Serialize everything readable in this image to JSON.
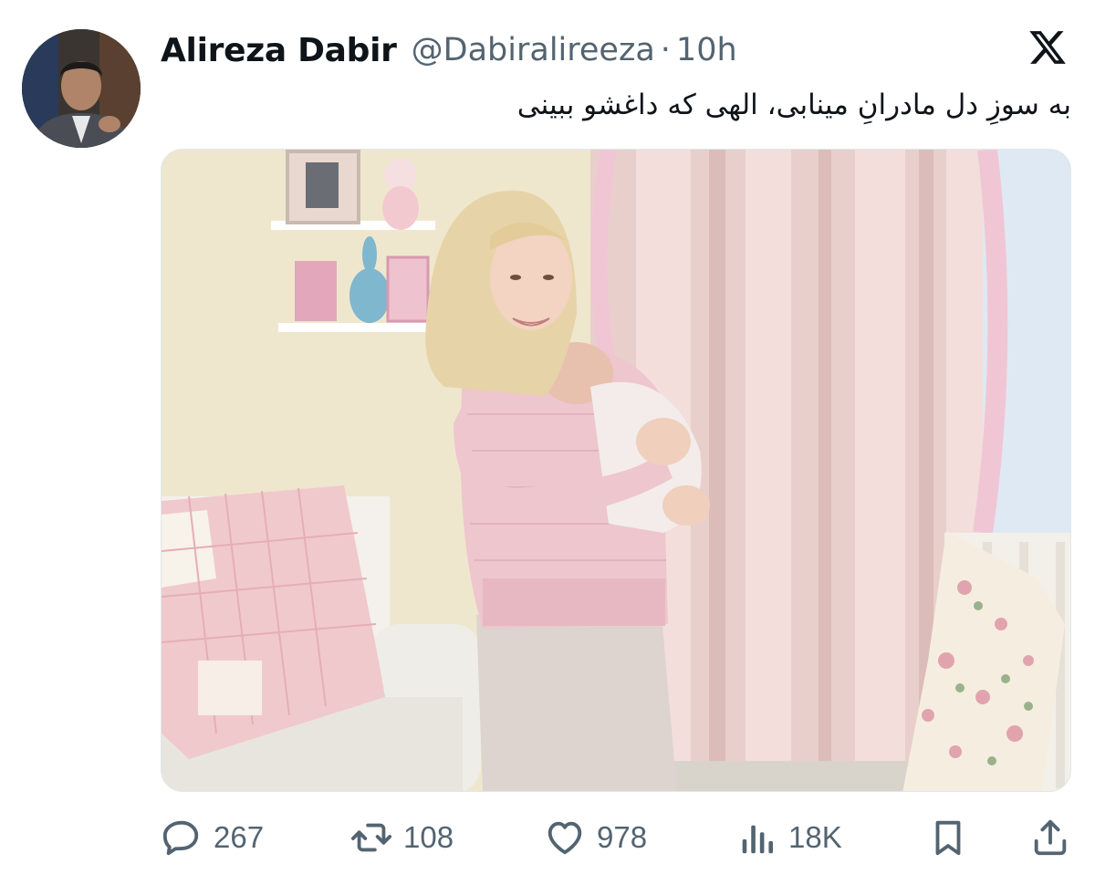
{
  "tweet": {
    "author": {
      "display_name": "Alireza Dabir",
      "handle": "@Dabiralireeza",
      "separator": "·",
      "time": "10h"
    },
    "text": "به سوزِ دل مادرانِ مینابی، الهی که داغشو ببینی",
    "platform_icon": "x-logo-icon"
  },
  "actions": {
    "reply": {
      "icon": "reply-icon",
      "count": "267"
    },
    "retweet": {
      "icon": "retweet-icon",
      "count": "108"
    },
    "like": {
      "icon": "heart-icon",
      "count": "978"
    },
    "views": {
      "icon": "views-icon",
      "count": "18K"
    },
    "bookmark": {
      "icon": "bookmark-icon"
    },
    "share": {
      "icon": "share-icon"
    }
  },
  "colors": {
    "text_primary": "#0f1419",
    "text_secondary": "#536471",
    "background": "#ffffff"
  }
}
